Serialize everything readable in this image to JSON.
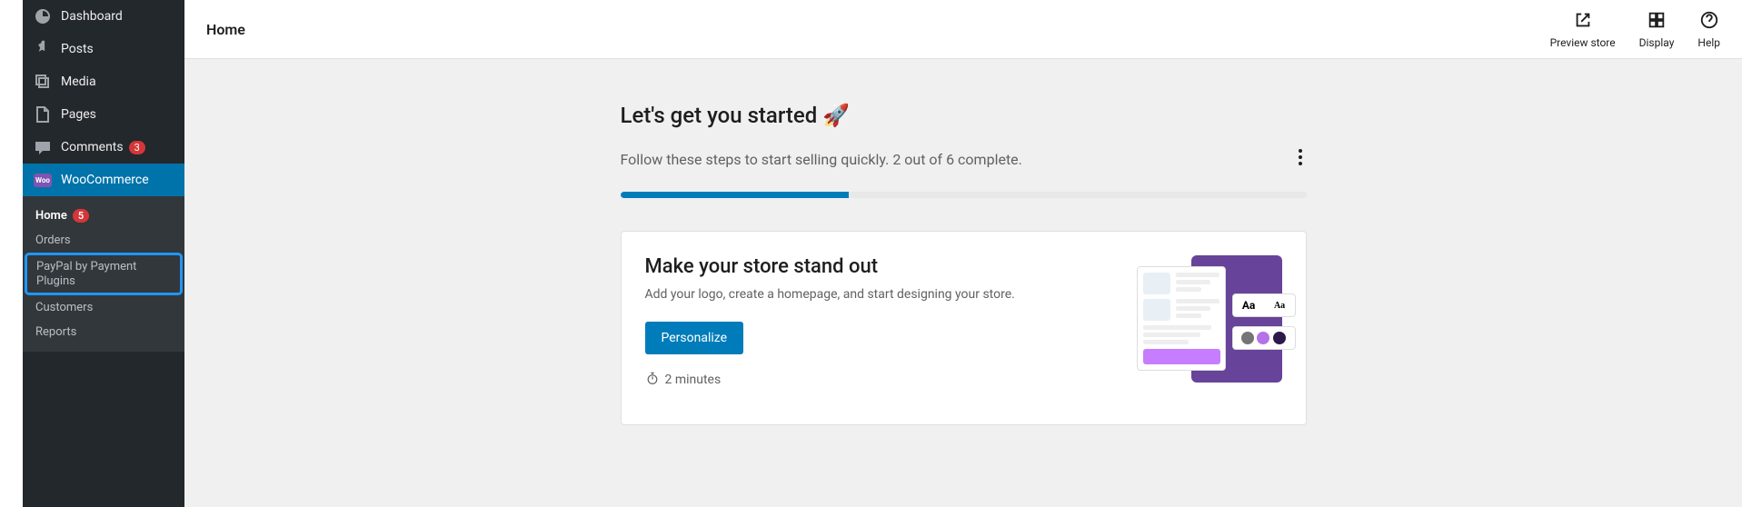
{
  "sidebar": {
    "dashboard": "Dashboard",
    "posts": "Posts",
    "media": "Media",
    "pages": "Pages",
    "comments": {
      "label": "Comments",
      "badge": "3"
    },
    "woocommerce": "WooCommerce",
    "submenu": {
      "home": {
        "label": "Home",
        "badge": "5"
      },
      "orders": "Orders",
      "paypal": "PayPal by Payment Plugins",
      "customers": "Customers",
      "reports": "Reports"
    }
  },
  "topbar": {
    "title": "Home",
    "preview": "Preview store",
    "display": "Display",
    "help": "Help"
  },
  "started": {
    "heading": "Let's get you started",
    "rocket": "🚀",
    "subline": "Follow these steps to start selling quickly. 2 out of 6 complete.",
    "progress_percent": 33.3
  },
  "card": {
    "title": "Make your store stand out",
    "desc": "Add your logo, create a homepage, and start designing your store.",
    "button": "Personalize",
    "time": "2 minutes",
    "font_a": "Aa",
    "font_b": "Aa",
    "dot_colors": [
      "#757575",
      "#b572e8",
      "#2b1a4a"
    ]
  }
}
